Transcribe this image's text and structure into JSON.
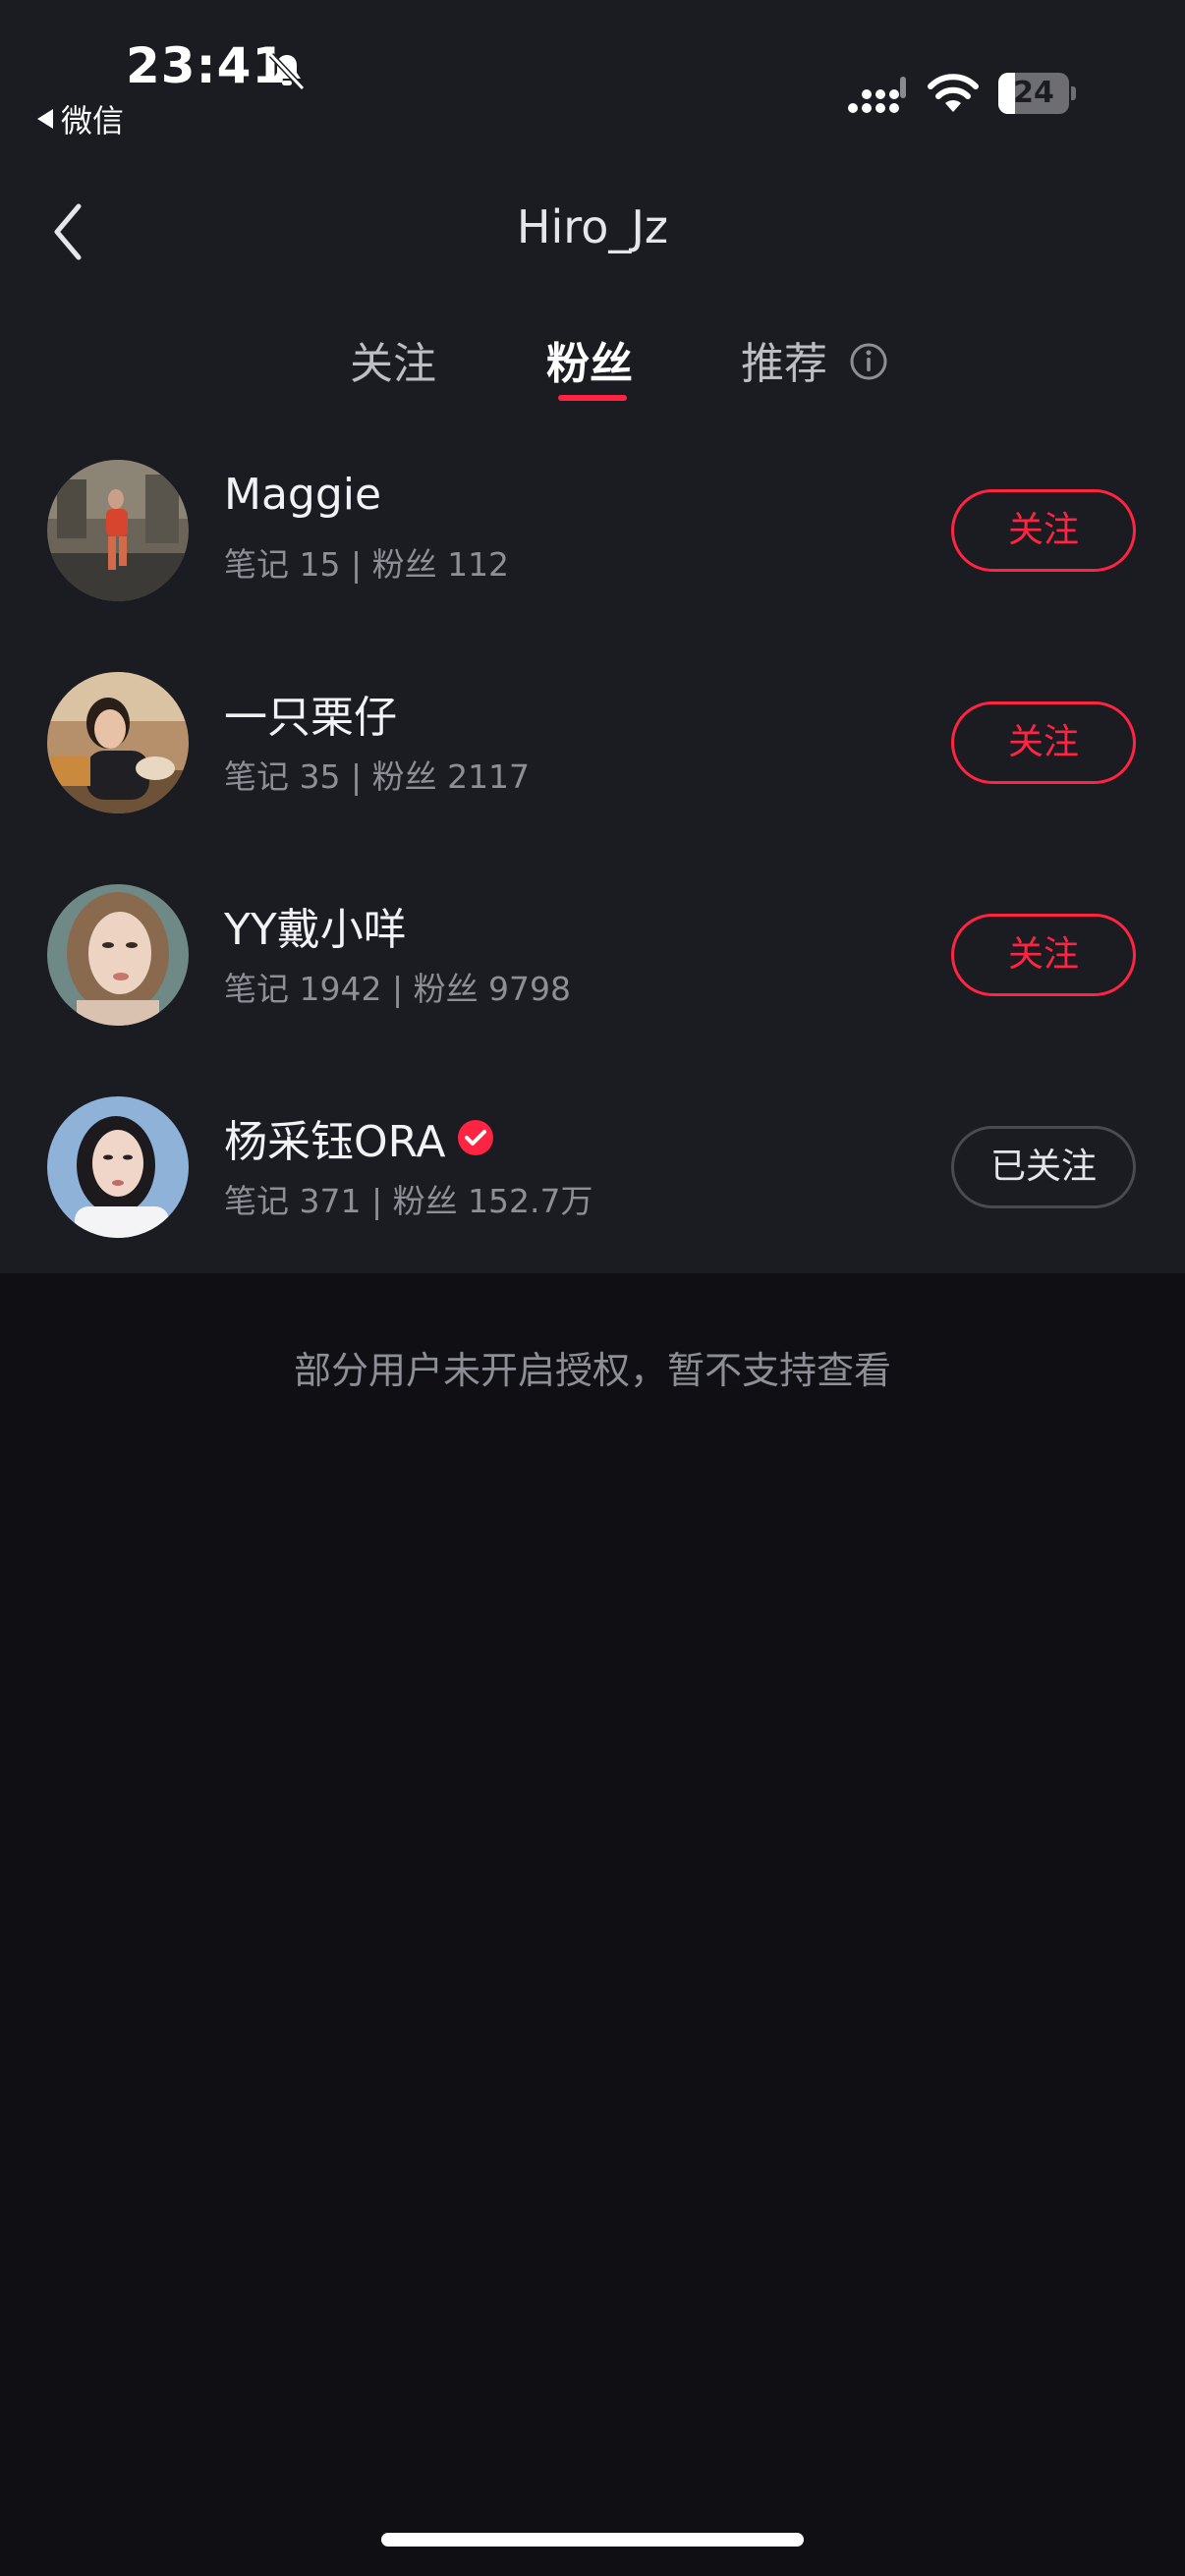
{
  "status_bar": {
    "time": "23:41",
    "back_app": "微信",
    "battery": "24",
    "battery_level": 0.24,
    "icons": [
      "bell-slash-icon",
      "signal-icon",
      "wifi-icon",
      "battery-icon"
    ]
  },
  "nav": {
    "title": "Hiro_Jz",
    "back_icon": "chevron-left-icon"
  },
  "tabs": [
    {
      "label": "关注",
      "active": false
    },
    {
      "label": "粉丝",
      "active": true
    },
    {
      "label": "推荐",
      "active": false,
      "icon": "info-icon"
    }
  ],
  "users": [
    {
      "name": "Maggie",
      "stats": "笔记 15 | 粉丝 112",
      "button": "关注",
      "verified": false
    },
    {
      "name": "一只栗仔",
      "stats": "笔记 35 | 粉丝 2117",
      "button": "关注",
      "verified": false
    },
    {
      "name": "YY戴小咩",
      "stats": "笔记 1942 | 粉丝 9798",
      "button": "关注",
      "verified": false
    },
    {
      "name": "杨采钰ORA",
      "stats": "笔记 371 | 粉丝 152.7万",
      "button": "已关注",
      "verified": true
    }
  ],
  "footer_note": "部分用户未开启授权，暂不支持查看",
  "colors": {
    "accent": "#ff2442",
    "background": "#0f0f14",
    "surface": "#1b1b22"
  }
}
